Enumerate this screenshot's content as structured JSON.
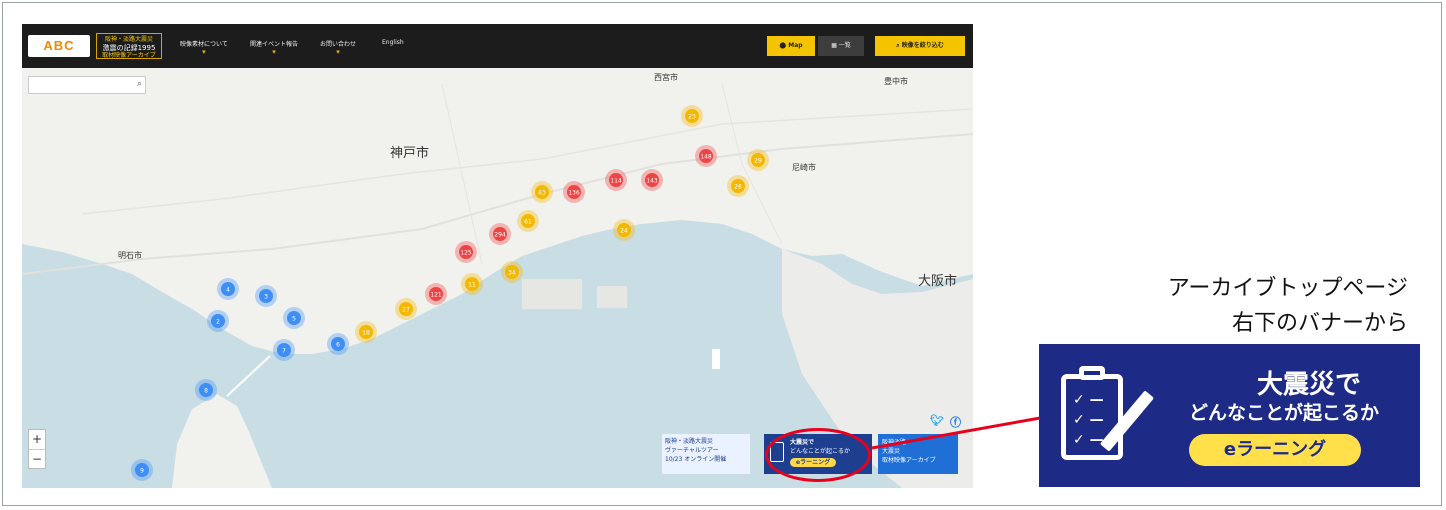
{
  "header": {
    "logo": "ABC",
    "archive_badge": [
      "阪神・淡路大震災",
      "激震の記録1995",
      "取材映像アーカイブ"
    ],
    "nav": [
      "映像素材について",
      "関連イベント報告",
      "お問い合わせ",
      "English"
    ],
    "map_button": "Map",
    "list_button": "一覧",
    "filter_button": "映像を絞り込む"
  },
  "map": {
    "cities": [
      "神戸市",
      "尼崎市",
      "大阪市",
      "明石市",
      "西宮市",
      "豊中市"
    ],
    "zoom_in": "+",
    "zoom_out": "−",
    "clusters": [
      {
        "label": "4",
        "color": "#3f8ef5"
      },
      {
        "label": "3",
        "color": "#3f8ef5"
      },
      {
        "label": "2",
        "color": "#3f8ef5"
      },
      {
        "label": "5",
        "color": "#3f8ef5"
      },
      {
        "label": "6",
        "color": "#3f8ef5"
      },
      {
        "label": "7",
        "color": "#3f8ef5"
      },
      {
        "label": "8",
        "color": "#3f8ef5"
      },
      {
        "label": "9",
        "color": "#3f8ef5"
      },
      {
        "label": "18",
        "color": "#f5b800"
      },
      {
        "label": "27",
        "color": "#f5b800"
      },
      {
        "label": "11",
        "color": "#f5b800"
      },
      {
        "label": "34",
        "color": "#f5b800"
      },
      {
        "label": "61",
        "color": "#f5b800"
      },
      {
        "label": "43",
        "color": "#f5b800"
      },
      {
        "label": "23",
        "color": "#f5b800"
      },
      {
        "label": "29",
        "color": "#f5b800"
      },
      {
        "label": "24",
        "color": "#f5b800"
      },
      {
        "label": "26",
        "color": "#f5b800"
      },
      {
        "label": "121",
        "color": "#ef4444"
      },
      {
        "label": "125",
        "color": "#ef4444"
      },
      {
        "label": "294",
        "color": "#ef4444"
      },
      {
        "label": "136",
        "color": "#ef4444"
      },
      {
        "label": "114",
        "color": "#ef4444"
      },
      {
        "label": "143",
        "color": "#ef4444"
      },
      {
        "label": "148",
        "color": "#ef4444"
      }
    ]
  },
  "banners": {
    "virtual_tour": [
      "阪神・淡路大震災",
      "ヴァーチャルツアー",
      "10/23 オンライン開催"
    ],
    "elearning_small": [
      "大震災で",
      "どんなことが起こるか",
      "eラーニング"
    ],
    "archive_small": [
      "阪神淡路",
      "大震災",
      "取材映像アーカイブ"
    ]
  },
  "annotation": {
    "caption_line1": "アーカイブトップページ",
    "caption_line2": "右下のバナーから",
    "banner_title1": "大震災で",
    "banner_title2": "どんなことが起こるか",
    "banner_button": "eラーニング",
    "highlight_color": "#e8001c"
  }
}
